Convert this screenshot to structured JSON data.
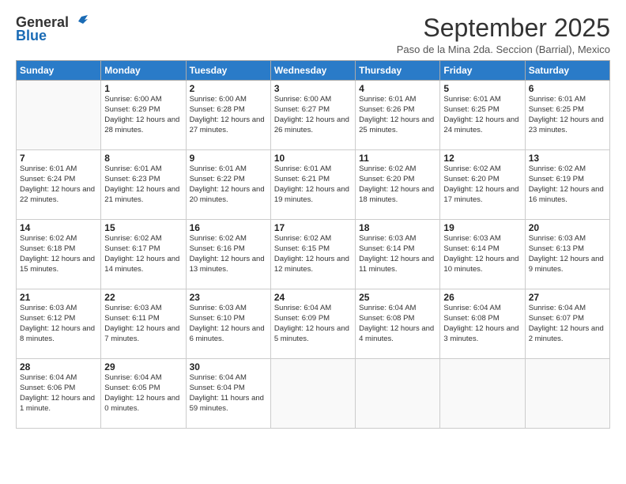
{
  "header": {
    "logo_general": "General",
    "logo_blue": "Blue",
    "month_title": "September 2025",
    "subtitle": "Paso de la Mina 2da. Seccion (Barrial), Mexico"
  },
  "days_of_week": [
    "Sunday",
    "Monday",
    "Tuesday",
    "Wednesday",
    "Thursday",
    "Friday",
    "Saturday"
  ],
  "weeks": [
    [
      {
        "num": "",
        "sunrise": "",
        "sunset": "",
        "daylight": ""
      },
      {
        "num": "1",
        "sunrise": "Sunrise: 6:00 AM",
        "sunset": "Sunset: 6:29 PM",
        "daylight": "Daylight: 12 hours and 28 minutes."
      },
      {
        "num": "2",
        "sunrise": "Sunrise: 6:00 AM",
        "sunset": "Sunset: 6:28 PM",
        "daylight": "Daylight: 12 hours and 27 minutes."
      },
      {
        "num": "3",
        "sunrise": "Sunrise: 6:00 AM",
        "sunset": "Sunset: 6:27 PM",
        "daylight": "Daylight: 12 hours and 26 minutes."
      },
      {
        "num": "4",
        "sunrise": "Sunrise: 6:01 AM",
        "sunset": "Sunset: 6:26 PM",
        "daylight": "Daylight: 12 hours and 25 minutes."
      },
      {
        "num": "5",
        "sunrise": "Sunrise: 6:01 AM",
        "sunset": "Sunset: 6:25 PM",
        "daylight": "Daylight: 12 hours and 24 minutes."
      },
      {
        "num": "6",
        "sunrise": "Sunrise: 6:01 AM",
        "sunset": "Sunset: 6:25 PM",
        "daylight": "Daylight: 12 hours and 23 minutes."
      }
    ],
    [
      {
        "num": "7",
        "sunrise": "Sunrise: 6:01 AM",
        "sunset": "Sunset: 6:24 PM",
        "daylight": "Daylight: 12 hours and 22 minutes."
      },
      {
        "num": "8",
        "sunrise": "Sunrise: 6:01 AM",
        "sunset": "Sunset: 6:23 PM",
        "daylight": "Daylight: 12 hours and 21 minutes."
      },
      {
        "num": "9",
        "sunrise": "Sunrise: 6:01 AM",
        "sunset": "Sunset: 6:22 PM",
        "daylight": "Daylight: 12 hours and 20 minutes."
      },
      {
        "num": "10",
        "sunrise": "Sunrise: 6:01 AM",
        "sunset": "Sunset: 6:21 PM",
        "daylight": "Daylight: 12 hours and 19 minutes."
      },
      {
        "num": "11",
        "sunrise": "Sunrise: 6:02 AM",
        "sunset": "Sunset: 6:20 PM",
        "daylight": "Daylight: 12 hours and 18 minutes."
      },
      {
        "num": "12",
        "sunrise": "Sunrise: 6:02 AM",
        "sunset": "Sunset: 6:20 PM",
        "daylight": "Daylight: 12 hours and 17 minutes."
      },
      {
        "num": "13",
        "sunrise": "Sunrise: 6:02 AM",
        "sunset": "Sunset: 6:19 PM",
        "daylight": "Daylight: 12 hours and 16 minutes."
      }
    ],
    [
      {
        "num": "14",
        "sunrise": "Sunrise: 6:02 AM",
        "sunset": "Sunset: 6:18 PM",
        "daylight": "Daylight: 12 hours and 15 minutes."
      },
      {
        "num": "15",
        "sunrise": "Sunrise: 6:02 AM",
        "sunset": "Sunset: 6:17 PM",
        "daylight": "Daylight: 12 hours and 14 minutes."
      },
      {
        "num": "16",
        "sunrise": "Sunrise: 6:02 AM",
        "sunset": "Sunset: 6:16 PM",
        "daylight": "Daylight: 12 hours and 13 minutes."
      },
      {
        "num": "17",
        "sunrise": "Sunrise: 6:02 AM",
        "sunset": "Sunset: 6:15 PM",
        "daylight": "Daylight: 12 hours and 12 minutes."
      },
      {
        "num": "18",
        "sunrise": "Sunrise: 6:03 AM",
        "sunset": "Sunset: 6:14 PM",
        "daylight": "Daylight: 12 hours and 11 minutes."
      },
      {
        "num": "19",
        "sunrise": "Sunrise: 6:03 AM",
        "sunset": "Sunset: 6:14 PM",
        "daylight": "Daylight: 12 hours and 10 minutes."
      },
      {
        "num": "20",
        "sunrise": "Sunrise: 6:03 AM",
        "sunset": "Sunset: 6:13 PM",
        "daylight": "Daylight: 12 hours and 9 minutes."
      }
    ],
    [
      {
        "num": "21",
        "sunrise": "Sunrise: 6:03 AM",
        "sunset": "Sunset: 6:12 PM",
        "daylight": "Daylight: 12 hours and 8 minutes."
      },
      {
        "num": "22",
        "sunrise": "Sunrise: 6:03 AM",
        "sunset": "Sunset: 6:11 PM",
        "daylight": "Daylight: 12 hours and 7 minutes."
      },
      {
        "num": "23",
        "sunrise": "Sunrise: 6:03 AM",
        "sunset": "Sunset: 6:10 PM",
        "daylight": "Daylight: 12 hours and 6 minutes."
      },
      {
        "num": "24",
        "sunrise": "Sunrise: 6:04 AM",
        "sunset": "Sunset: 6:09 PM",
        "daylight": "Daylight: 12 hours and 5 minutes."
      },
      {
        "num": "25",
        "sunrise": "Sunrise: 6:04 AM",
        "sunset": "Sunset: 6:08 PM",
        "daylight": "Daylight: 12 hours and 4 minutes."
      },
      {
        "num": "26",
        "sunrise": "Sunrise: 6:04 AM",
        "sunset": "Sunset: 6:08 PM",
        "daylight": "Daylight: 12 hours and 3 minutes."
      },
      {
        "num": "27",
        "sunrise": "Sunrise: 6:04 AM",
        "sunset": "Sunset: 6:07 PM",
        "daylight": "Daylight: 12 hours and 2 minutes."
      }
    ],
    [
      {
        "num": "28",
        "sunrise": "Sunrise: 6:04 AM",
        "sunset": "Sunset: 6:06 PM",
        "daylight": "Daylight: 12 hours and 1 minute."
      },
      {
        "num": "29",
        "sunrise": "Sunrise: 6:04 AM",
        "sunset": "Sunset: 6:05 PM",
        "daylight": "Daylight: 12 hours and 0 minutes."
      },
      {
        "num": "30",
        "sunrise": "Sunrise: 6:04 AM",
        "sunset": "Sunset: 6:04 PM",
        "daylight": "Daylight: 11 hours and 59 minutes."
      },
      {
        "num": "",
        "sunrise": "",
        "sunset": "",
        "daylight": ""
      },
      {
        "num": "",
        "sunrise": "",
        "sunset": "",
        "daylight": ""
      },
      {
        "num": "",
        "sunrise": "",
        "sunset": "",
        "daylight": ""
      },
      {
        "num": "",
        "sunrise": "",
        "sunset": "",
        "daylight": ""
      }
    ]
  ]
}
